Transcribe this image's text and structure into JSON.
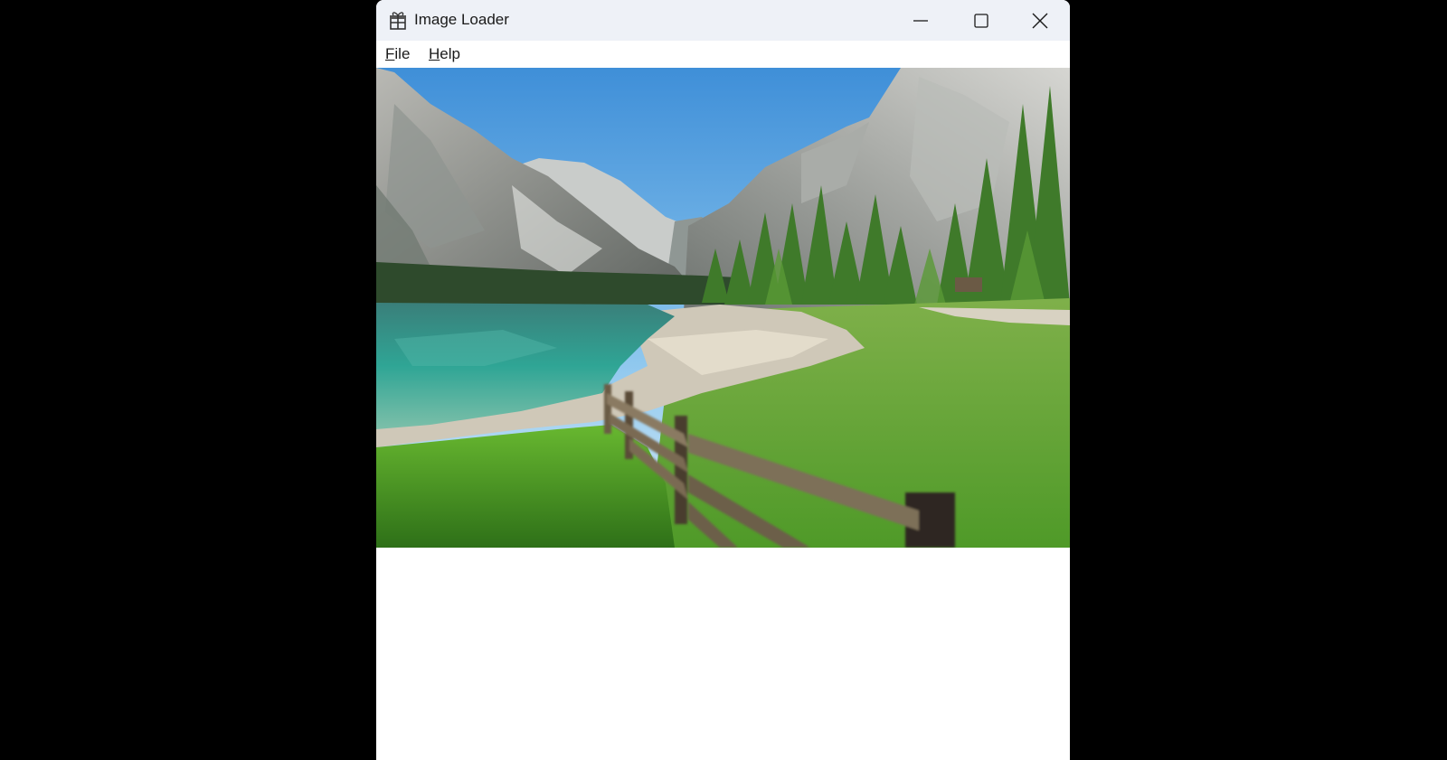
{
  "window": {
    "title": "Image Loader",
    "icon": "gift-box-icon",
    "controls": {
      "minimize_icon": "minimize-icon",
      "maximize_icon": "maximize-icon",
      "close_icon": "close-icon"
    }
  },
  "menu": {
    "items": [
      {
        "mnemonic": "F",
        "rest": "ile"
      },
      {
        "mnemonic": "H",
        "rest": "elp"
      }
    ]
  },
  "colors": {
    "titlebar": "#eef1f7",
    "desktop": "#000000",
    "client": "#ffffff"
  }
}
